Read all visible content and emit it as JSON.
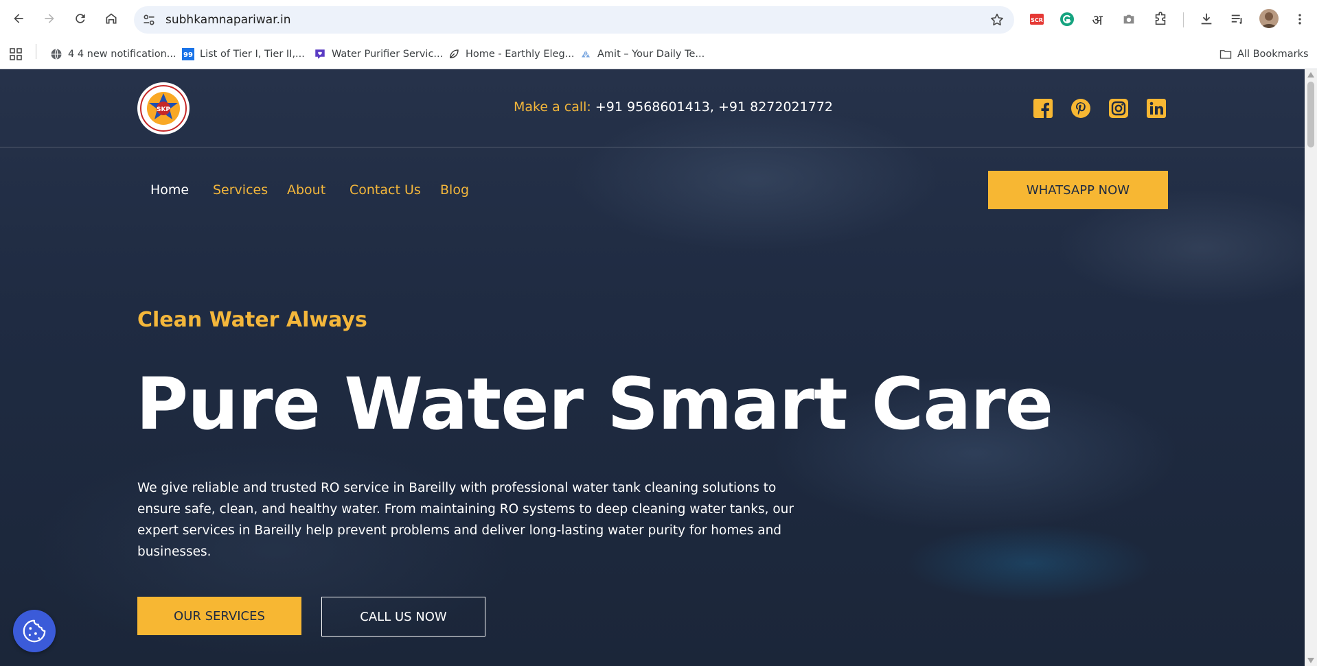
{
  "browser": {
    "url": "subhkamnapariwar.in",
    "bookmarks": [
      {
        "label": "4 4 new notification...",
        "icon": "globe-icon"
      },
      {
        "label": "List of Tier I, Tier II,...",
        "icon": "99-favicon"
      },
      {
        "label": "Water Purifier Servic...",
        "icon": "heart-chat-favicon"
      },
      {
        "label": "Home - Earthly Eleg...",
        "icon": "leaf-favicon"
      },
      {
        "label": "Amit – Your Daily Te...",
        "icon": "shell-favicon"
      }
    ],
    "all_bookmarks_label": "All Bookmarks",
    "extensions": [
      "scribe-icon",
      "grammarly-icon",
      "hindi-input-icon",
      "camera-icon",
      "puzzle-icon"
    ]
  },
  "header": {
    "logo_alt": "SKP",
    "call_label": "Make a call:",
    "phones": "+91 9568601413, +91 8272021772",
    "social": [
      "facebook-icon",
      "pinterest-icon",
      "instagram-icon",
      "linkedin-icon"
    ]
  },
  "nav": {
    "items": [
      {
        "label": "Home",
        "active": true
      },
      {
        "label": "Services",
        "active": false
      },
      {
        "label": "About",
        "active": false
      },
      {
        "label": "Contact Us",
        "active": false
      },
      {
        "label": "Blog",
        "active": false
      }
    ],
    "cta": "WHATSAPP NOW"
  },
  "hero": {
    "eyebrow": "Clean Water Always",
    "headline": "Pure Water Smart Care",
    "lead": "We give reliable and trusted RO service in Bareilly with professional water tank cleaning solutions to ensure safe, clean, and healthy water. From maintaining RO systems to deep cleaning water tanks, our expert services in Bareilly help prevent problems and deliver long-lasting water purity for homes and businesses.",
    "primary_btn": "OUR SERVICES",
    "secondary_btn": "CALL US NOW"
  },
  "colors": {
    "accent": "#f7b733",
    "accent_text": "#f4b73b",
    "hero_bg": "#1f2b42",
    "cookie_bg": "#3b5bd9"
  }
}
